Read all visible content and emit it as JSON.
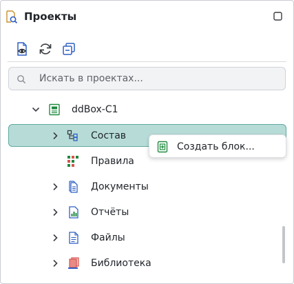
{
  "panel": {
    "title": "Проекты",
    "icon": "project-search-icon",
    "maximize_icon": "maximize-icon"
  },
  "toolbar": {
    "buttons": [
      {
        "icon": "document-eye-icon"
      },
      {
        "icon": "refresh-icon"
      },
      {
        "icon": "collapse-all-icon"
      }
    ]
  },
  "search": {
    "placeholder": "Искать в проектах...",
    "value": "",
    "icon": "search-icon"
  },
  "tree": {
    "root": {
      "label": "ddBox-C1",
      "expanded": true,
      "icon": "device-icon"
    },
    "items": [
      {
        "label": "Состав",
        "icon": "structure-icon",
        "expandable": true,
        "selected": true
      },
      {
        "label": "Правила",
        "icon": "rules-icon",
        "expandable": false
      },
      {
        "label": "Документы",
        "icon": "documents-icon",
        "expandable": true
      },
      {
        "label": "Отчёты",
        "icon": "reports-icon",
        "expandable": true
      },
      {
        "label": "Файлы",
        "icon": "files-icon",
        "expandable": true
      },
      {
        "label": "Библиотека",
        "icon": "library-icon",
        "expandable": true
      }
    ]
  },
  "context_menu": {
    "items": [
      {
        "label": "Создать блок...",
        "icon": "create-block-icon"
      }
    ]
  },
  "colors": {
    "selection_bg": "#b7dcd8",
    "selection_border": "#5ea7a0",
    "icon_blue": "#2f5fc4",
    "icon_green": "#1f8a3e",
    "icon_red": "#d9534f"
  }
}
